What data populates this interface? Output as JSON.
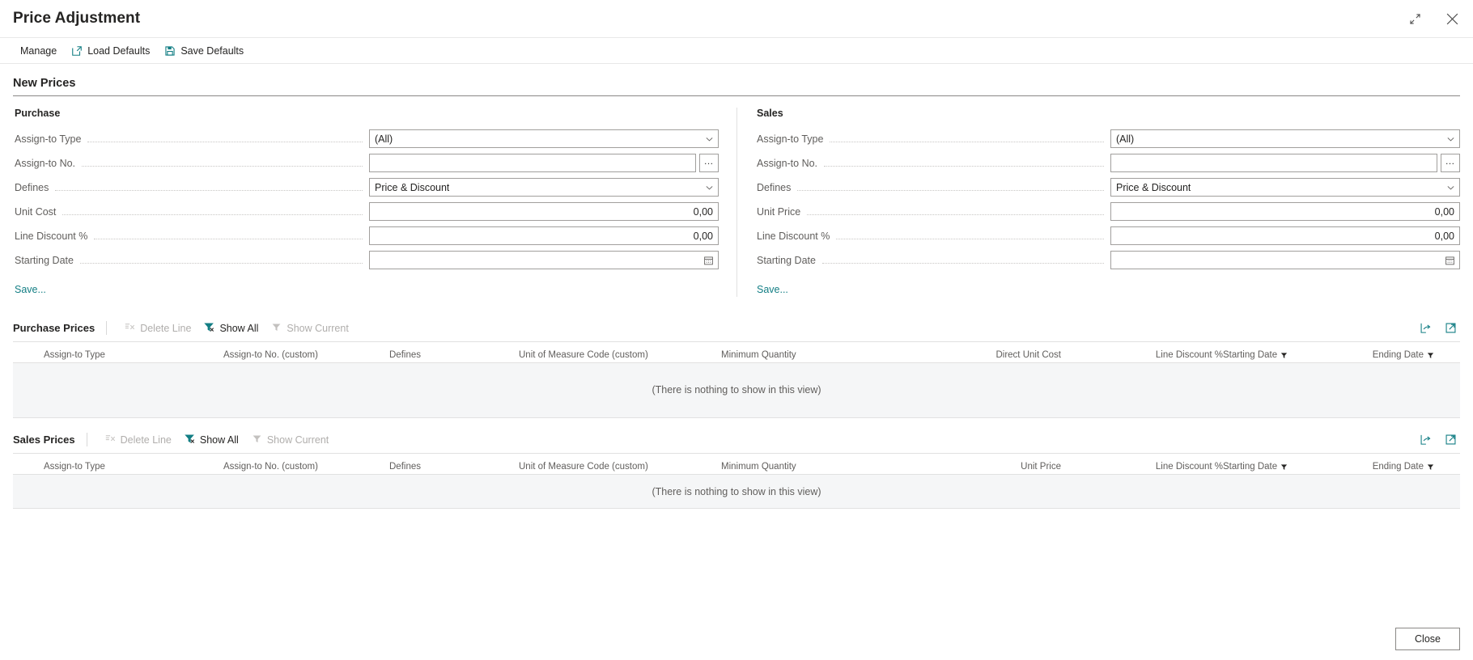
{
  "window": {
    "title": "Price Adjustment",
    "restore_icon": "restore-down-icon",
    "close_icon": "close-icon"
  },
  "ribbon": {
    "manage_label": "Manage",
    "load_defaults_label": "Load Defaults",
    "save_defaults_label": "Save Defaults"
  },
  "section": {
    "title": "New Prices"
  },
  "colors": {
    "accent": "#137E84",
    "text": "#252423",
    "label": "#605e5c",
    "disabled": "#b0aeac",
    "border": "#a19f9d",
    "grid_bg": "#f5f6f7"
  },
  "purchase": {
    "group_label": "Purchase",
    "fields": [
      {
        "label": "Assign-to Type",
        "value": "(All)",
        "type": "dropdown"
      },
      {
        "label": "Assign-to No.",
        "value": "",
        "type": "lookup"
      },
      {
        "label": "Defines",
        "value": "Price & Discount",
        "type": "dropdown"
      },
      {
        "label": "Unit Cost",
        "value": "0,00",
        "type": "decimal"
      },
      {
        "label": "Line Discount %",
        "value": "0,00",
        "type": "decimal"
      },
      {
        "label": "Starting Date",
        "value": "",
        "type": "date"
      }
    ],
    "save_label": "Save..."
  },
  "sales": {
    "group_label": "Sales",
    "fields": [
      {
        "label": "Assign-to Type",
        "value": "(All)",
        "type": "dropdown"
      },
      {
        "label": "Assign-to No.",
        "value": "",
        "type": "lookup"
      },
      {
        "label": "Defines",
        "value": "Price & Discount",
        "type": "dropdown"
      },
      {
        "label": "Unit Price",
        "value": "0,00",
        "type": "decimal"
      },
      {
        "label": "Line Discount %",
        "value": "0,00",
        "type": "decimal"
      },
      {
        "label": "Starting Date",
        "value": "",
        "type": "date"
      }
    ],
    "save_label": "Save..."
  },
  "purchase_prices": {
    "title": "Purchase Prices",
    "actions": [
      {
        "label": "Delete Line",
        "icon": "delete-line-icon",
        "enabled": false
      },
      {
        "label": "Show All",
        "icon": "show-all-icon",
        "enabled": true
      },
      {
        "label": "Show Current",
        "icon": "filter-icon",
        "enabled": false
      }
    ],
    "right_icons": [
      "open-in-excel-icon",
      "open-in-new-window-icon"
    ],
    "columns": [
      {
        "label": "Assign-to Type",
        "filter": false
      },
      {
        "label": "Assign-to No. (custom)",
        "filter": false
      },
      {
        "label": "Defines",
        "filter": false
      },
      {
        "label": "Unit of Measure Code (custom)",
        "filter": false
      },
      {
        "label": "Minimum Quantity",
        "filter": false
      },
      {
        "label": "Direct Unit Cost",
        "filter": false
      },
      {
        "label": "Line Discount %",
        "filter": false
      },
      {
        "label": "Starting Date",
        "filter": true
      },
      {
        "label": "Ending Date",
        "filter": true
      }
    ],
    "rows": [],
    "empty_text": "(There is nothing to show in this view)"
  },
  "sales_prices": {
    "title": "Sales Prices",
    "actions": [
      {
        "label": "Delete Line",
        "icon": "delete-line-icon",
        "enabled": false
      },
      {
        "label": "Show All",
        "icon": "show-all-icon",
        "enabled": true
      },
      {
        "label": "Show Current",
        "icon": "filter-icon",
        "enabled": false
      }
    ],
    "right_icons": [
      "open-in-excel-icon",
      "open-in-new-window-icon"
    ],
    "columns": [
      {
        "label": "Assign-to Type",
        "filter": false
      },
      {
        "label": "Assign-to No. (custom)",
        "filter": false
      },
      {
        "label": "Defines",
        "filter": false
      },
      {
        "label": "Unit of Measure Code (custom)",
        "filter": false
      },
      {
        "label": "Minimum Quantity",
        "filter": false
      },
      {
        "label": "Unit Price",
        "filter": false
      },
      {
        "label": "Line Discount %",
        "filter": false
      },
      {
        "label": "Starting Date",
        "filter": true
      },
      {
        "label": "Ending Date",
        "filter": true
      }
    ],
    "rows": [],
    "empty_text": "(There is nothing to show in this view)"
  },
  "footer": {
    "close_label": "Close"
  }
}
